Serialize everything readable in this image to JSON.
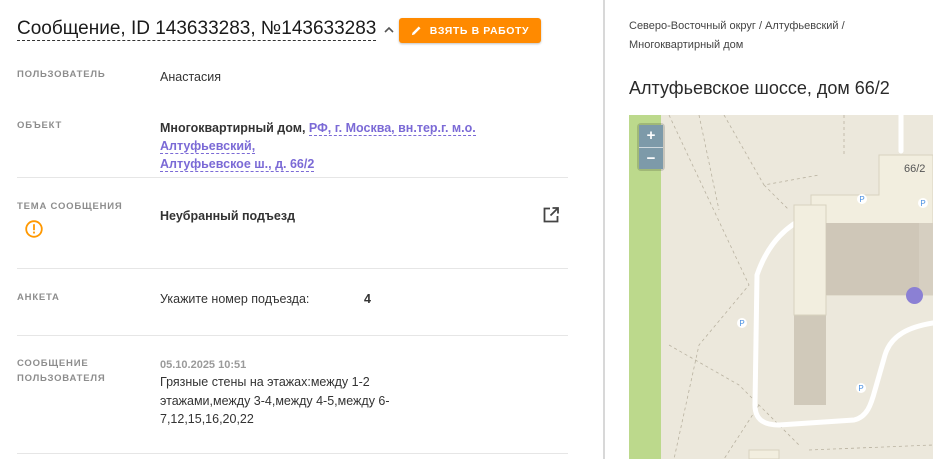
{
  "header": {
    "title": "Сообщение, ID 143633283, №143633283",
    "take_button": "ВЗЯТЬ В РАБОТУ"
  },
  "fields": {
    "user": {
      "label": "ПОЛЬЗОВАТЕЛЬ",
      "value": "Анастасия"
    },
    "object": {
      "label": "ОБЪЕКТ",
      "type": "Многоквартирный дом,",
      "address_line1": "РФ, г. Москва, вн.тер.г. м.о. Алтуфьевский,",
      "address_line2": "Алтуфьевское ш., д. 66/2"
    },
    "topic": {
      "label": "ТЕМА СООБЩЕНИЯ",
      "value": "Неубранный подъезд"
    },
    "survey": {
      "label": "АНКЕТА",
      "question": "Укажите номер подъезда:",
      "answer": "4"
    },
    "user_message": {
      "label_line1": "СООБЩЕНИЕ",
      "label_line2": "ПОЛЬЗОВАТЕЛЯ",
      "date": "05.10.2025 10:51",
      "text_line1": "Грязные стены на этажах:между 1-2",
      "text_line2": "этажами,между 3-4,между 4-5,между 6-",
      "text_line3": "7,12,15,16,20,22"
    }
  },
  "side": {
    "breadcrumb_line1": "Северо-Восточный округ / Алтуфьевский /",
    "breadcrumb_line2": "Многоквартирный дом",
    "address": "Алтуфьевское шоссе, дом 66/2",
    "map": {
      "zoom_in": "+",
      "zoom_out": "−",
      "building_label": "66/2",
      "parking_symbol": "P"
    }
  },
  "colors": {
    "accent": "#ff8a00",
    "link": "#7b6ad6",
    "warning": "#ff9800",
    "marker": "#8b80d4",
    "zoom": "#7d9aa9"
  }
}
